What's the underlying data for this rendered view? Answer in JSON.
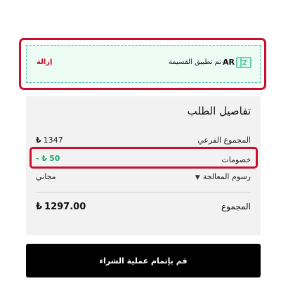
{
  "coupon": {
    "remove_label": "إزالة",
    "applied_text": "تم تطبيق القسيمة",
    "code": "AR",
    "icon": "coupon-ticket-icon",
    "accent": "#42c79a",
    "highlight_color": "#c8102e"
  },
  "summary": {
    "title": "تفاصيل الطلب",
    "subtotal": {
      "label": "المجموع الفرعي",
      "value": "1347",
      "currency": "₺"
    },
    "discount": {
      "label": "خصومات",
      "value": "50",
      "prefix": "-",
      "currency": "₺",
      "color": "#1fa973"
    },
    "processing": {
      "label": "رسوم المعالجة",
      "value": "مجاني",
      "icon": "chevron-down-icon"
    },
    "total": {
      "label": "المجموع",
      "value": "1297.00",
      "currency": "₺"
    }
  },
  "checkout": {
    "label": "قم بإتمام عملية الشراء"
  }
}
